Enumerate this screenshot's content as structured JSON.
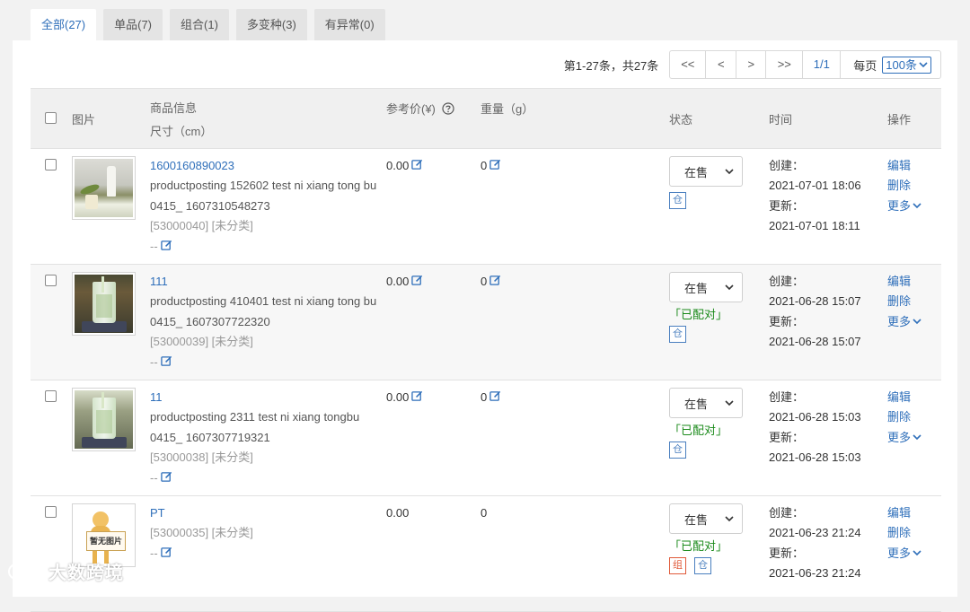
{
  "tabs": [
    {
      "label": "全部(27)",
      "active": true
    },
    {
      "label": "单品(7)",
      "active": false
    },
    {
      "label": "组合(1)",
      "active": false
    },
    {
      "label": "多变种(3)",
      "active": false
    },
    {
      "label": "有异常(0)",
      "active": false
    }
  ],
  "pager": {
    "summary": "第1-27条，共27条",
    "first": "<<",
    "prev": "<",
    "next": ">",
    "last": ">>",
    "page": "1/1",
    "per_page_label": "每页",
    "per_page_value": "100条"
  },
  "columns": {
    "image": "图片",
    "info": "商品信息",
    "size": "尺寸（cm）",
    "price": "参考价(¥)",
    "weight": "重量（g）",
    "status": "状态",
    "time": "时间",
    "actions": "操作"
  },
  "labels": {
    "created": "创建：",
    "updated": "更新：",
    "edit": "编辑",
    "delete": "删除",
    "more": "更多",
    "matched": "「已配对」",
    "warehouse_badge": "仓",
    "combo_badge": "组"
  },
  "rows": [
    {
      "sku": "1600160890023",
      "title": "productposting 152602 test ni xiang tong bu 0415_ 1607310548273",
      "code": "[53000040] [未分类]",
      "size": "--",
      "price": "0.00",
      "weight": "0",
      "status": "在售",
      "matched": false,
      "combo": false,
      "created": "2021-07-01 18:06",
      "updated": "2021-07-01 18:11",
      "image": "product-bottle-photo"
    },
    {
      "sku": "111",
      "title": "productposting 410401 test ni xiang tong bu 0415_ 1607307722320",
      "code": "[53000039] [未分类]",
      "size": "--",
      "price": "0.00",
      "weight": "0",
      "status": "在售",
      "matched": true,
      "combo": false,
      "created": "2021-06-28 15:07",
      "updated": "2021-06-28 15:07",
      "image": "product-glass-photo"
    },
    {
      "sku": "11",
      "title": "productposting 2311 test ni xiang tongbu 0415_ 1607307719321",
      "code": "[53000038] [未分类]",
      "size": "--",
      "price": "0.00",
      "weight": "0",
      "status": "在售",
      "matched": true,
      "combo": false,
      "created": "2021-06-28 15:03",
      "updated": "2021-06-28 15:03",
      "image": "product-glass-photo"
    },
    {
      "sku": "PT",
      "title": "",
      "code": "[53000035] [未分类]",
      "size": "--",
      "price": "0.00",
      "weight": "0",
      "status": "在售",
      "matched": true,
      "combo": true,
      "created": "2021-06-23 21:24",
      "updated": "2021-06-23 21:24",
      "image": "no-image-placeholder",
      "placeholder_text": "暂无图片"
    }
  ],
  "watermark": "大数跨境",
  "colors": {
    "link": "#2f6fba",
    "matched": "#1a8a1a",
    "combo_badge": "#e05a3a",
    "header_bg": "#f0f0f0"
  }
}
